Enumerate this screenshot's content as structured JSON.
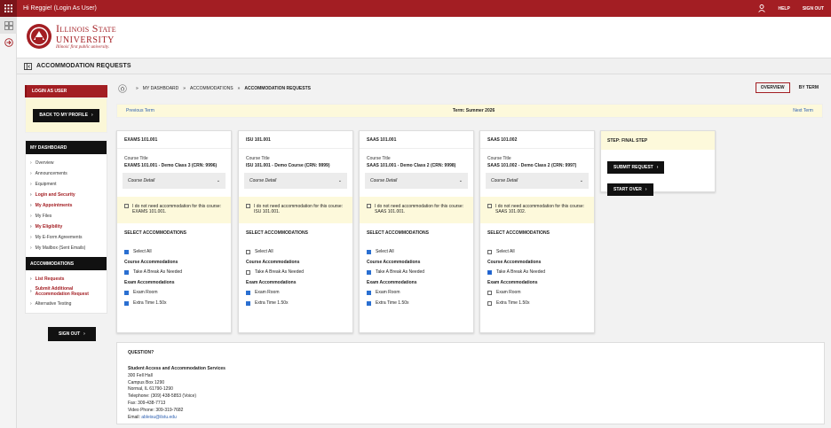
{
  "topbar": {
    "greeting": "Hi Reggie! (Login As User)",
    "help": "HELP",
    "signout": "SIGN OUT"
  },
  "header": {
    "logo_line1": "Illinois State",
    "logo_line2": "UNIVERSITY",
    "logo_tagline": "Illinois' first public university."
  },
  "page": {
    "title": "ACCOMMODATION REQUESTS"
  },
  "sidebar": {
    "login_as_user": "LOGIN AS USER",
    "back_to_profile": "BACK TO MY PROFILE",
    "dashboard_heading": "MY DASHBOARD",
    "dashboard_items": [
      {
        "label": "Overview",
        "highlight": false
      },
      {
        "label": "Announcements",
        "highlight": false
      },
      {
        "label": "Equipment",
        "highlight": false
      },
      {
        "label": "Login and Security",
        "highlight": true
      },
      {
        "label": "My Appointments",
        "highlight": true
      },
      {
        "label": "My Files",
        "highlight": false
      },
      {
        "label": "My Eligibility",
        "highlight": true
      },
      {
        "label": "My E-Form Agreements",
        "highlight": false
      },
      {
        "label": "My Mailbox (Sent Emails)",
        "highlight": false
      }
    ],
    "accommodations_heading": "ACCOMMODATIONS",
    "accommodations_items": [
      {
        "label": "List Requests",
        "highlight": true
      },
      {
        "label": "Submit Additional Accommodation Request",
        "highlight": true
      },
      {
        "label": "Alternative Testing",
        "highlight": false
      }
    ],
    "sign_out": "SIGN OUT"
  },
  "breadcrumb": {
    "items": [
      "MY DASHBOARD",
      "ACCOMMODATIONS",
      "ACCOMMODATION REQUESTS"
    ]
  },
  "view_toggle": {
    "overview": "OVERVIEW",
    "by_term": "BY TERM"
  },
  "term": {
    "previous": "Previous Term",
    "current": "Term: Summer 2026",
    "next": "Next Term"
  },
  "cards": [
    {
      "code": "EXAMS 101.001",
      "course_title_label": "Course Title",
      "course_title": "EXAMS 101.001 - Demo Class 3 (CRN: 9996)",
      "course_detail": "Course Detail",
      "no_accommodation": "I do not need accommodation for this course: EXAMS 101.001.",
      "select_heading": "SELECT ACCOMMODATIONS",
      "select_all": "Select All",
      "select_all_checked": true,
      "course_acc_heading": "Course Accommodations",
      "course_acc": [
        {
          "label": "Take A Break As Needed",
          "checked": true
        }
      ],
      "exam_acc_heading": "Exam Accommodations",
      "exam_acc": [
        {
          "label": "Exam Room",
          "checked": true
        },
        {
          "label": "Extra Time 1.50x",
          "checked": true
        }
      ]
    },
    {
      "code": "ISU 101.001",
      "course_title_label": "Course Title",
      "course_title": "ISU 101.001 - Demo Course (CRN: 9999)",
      "course_detail": "Course Detail",
      "no_accommodation": "I do not need accommodation for this course: ISU 101.001.",
      "select_heading": "SELECT ACCOMMODATIONS",
      "select_all": "Select All",
      "select_all_checked": false,
      "course_acc_heading": "Course Accommodations",
      "course_acc": [
        {
          "label": "Take A Break As Needed",
          "checked": false
        }
      ],
      "exam_acc_heading": "Exam Accommodations",
      "exam_acc": [
        {
          "label": "Exam Room",
          "checked": true
        },
        {
          "label": "Extra Time 1.50x",
          "checked": true
        }
      ]
    },
    {
      "code": "SAAS 101.001",
      "course_title_label": "Course Title",
      "course_title": "SAAS 101.001 - Demo Class 2 (CRN: 9998)",
      "course_detail": "Course Detail",
      "no_accommodation": "I do not need accommodation for this course: SAAS 101.001.",
      "select_heading": "SELECT ACCOMMODATIONS",
      "select_all": "Select All",
      "select_all_checked": true,
      "course_acc_heading": "Course Accommodations",
      "course_acc": [
        {
          "label": "Take A Break As Needed",
          "checked": true
        }
      ],
      "exam_acc_heading": "Exam Accommodations",
      "exam_acc": [
        {
          "label": "Exam Room",
          "checked": true
        },
        {
          "label": "Extra Time 1.50x",
          "checked": true
        }
      ]
    },
    {
      "code": "SAAS 101.002",
      "course_title_label": "Course Title",
      "course_title": "SAAS 101.002 - Demo Class 2 (CRN: 9997)",
      "course_detail": "Course Detail",
      "no_accommodation": "I do not need accommodation for this course: SAAS 101.002.",
      "select_heading": "SELECT ACCOMMODATIONS",
      "select_all": "Select All",
      "select_all_checked": false,
      "course_acc_heading": "Course Accommodations",
      "course_acc": [
        {
          "label": "Take A Break As Needed",
          "checked": true
        }
      ],
      "exam_acc_heading": "Exam Accommodations",
      "exam_acc": [
        {
          "label": "Exam Room",
          "checked": false
        },
        {
          "label": "Extra Time 1.50x",
          "checked": false
        }
      ]
    }
  ],
  "step": {
    "heading": "STEP: FINAL STEP",
    "submit": "SUBMIT REQUEST",
    "start_over": "START OVER"
  },
  "question": {
    "heading": "QUESTION?",
    "org": "Student Access and Accommodation Services",
    "lines": [
      "300 Fell Hall",
      "Campus Box 1290",
      "Normal, IL 61790-1290",
      "Telephone: (309) 438-5853 (Voice)",
      "Fax: 309-438-7713",
      "Video Phone: 309-319-7682"
    ],
    "email_label": "Email: ",
    "email": "ableisu@ilstu.edu"
  },
  "colors": {
    "brand_red": "#a31e23",
    "highlight_yellow": "#fdf9db",
    "check_blue": "#2a6fd1"
  }
}
